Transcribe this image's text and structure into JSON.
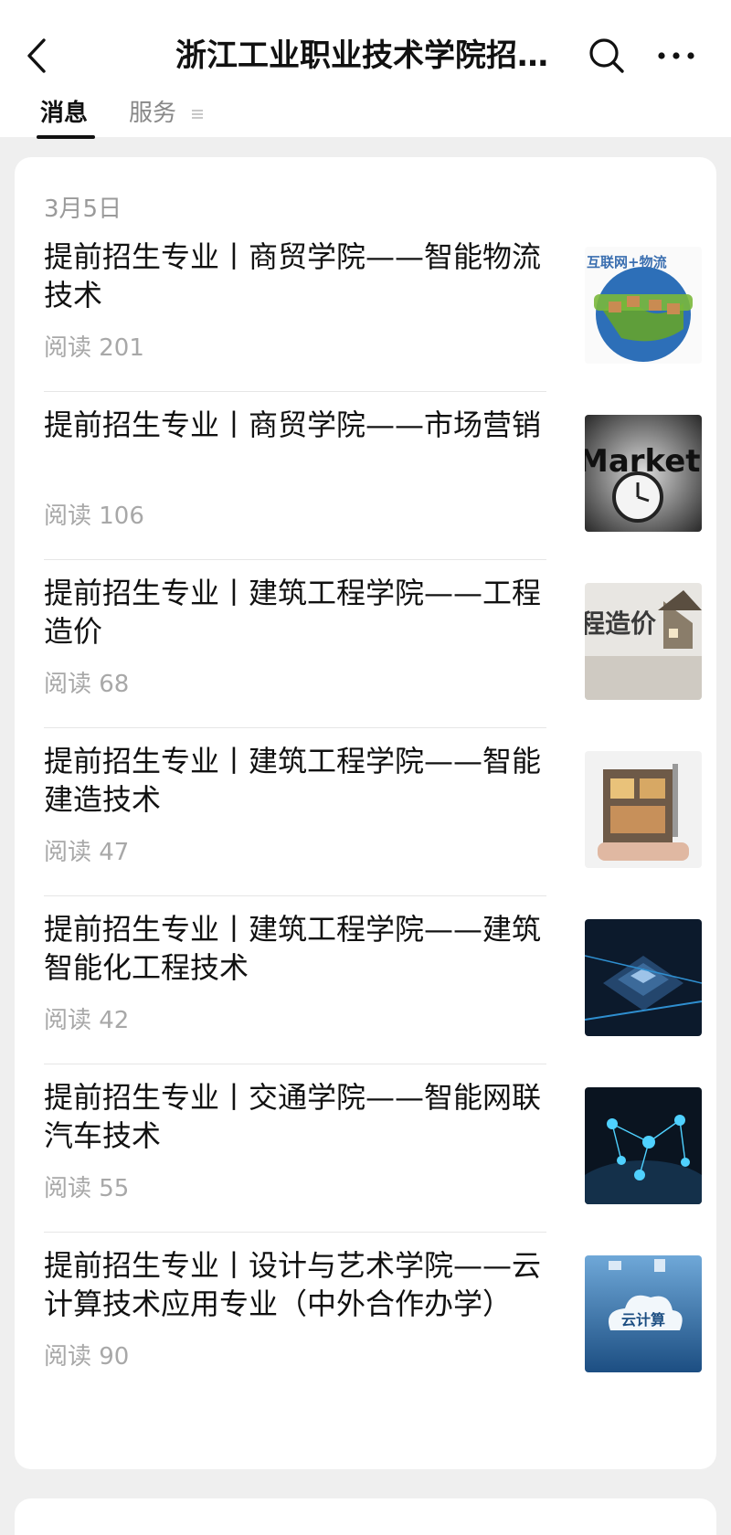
{
  "header": {
    "title": "浙江工业职业技术学院招…",
    "back_icon": "chevron-left-icon",
    "search_icon": "search-icon",
    "more_icon": "more-icon"
  },
  "tabs": [
    {
      "label": "消息",
      "active": true
    },
    {
      "label": "服务",
      "active": false,
      "icon": "menu-icon"
    }
  ],
  "feed": {
    "date": "3月5日",
    "articles": [
      {
        "title": "提前招生专业丨商贸学院——智能物流技术",
        "reads": "阅读 201",
        "thumb_text": "互联网+物流"
      },
      {
        "title": "提前招生专业丨商贸学院——市场营销",
        "reads": "阅读 106",
        "thumb_text": "Marketing"
      },
      {
        "title": "提前招生专业丨建筑工程学院——工程造价",
        "reads": "阅读 68",
        "thumb_text": "程造价"
      },
      {
        "title": "提前招生专业丨建筑工程学院——智能建造技术",
        "reads": "阅读 47",
        "thumb_text": ""
      },
      {
        "title": "提前招生专业丨建筑工程学院——建筑智能化工程技术",
        "reads": "阅读 42",
        "thumb_text": ""
      },
      {
        "title": "提前招生专业丨交通学院——智能网联汽车技术",
        "reads": "阅读 55",
        "thumb_text": ""
      },
      {
        "title": "提前招生专业丨设计与艺术学院——云计算技术应用专业（中外合作办学）",
        "reads": "阅读 90",
        "thumb_text": "云计算"
      }
    ]
  }
}
